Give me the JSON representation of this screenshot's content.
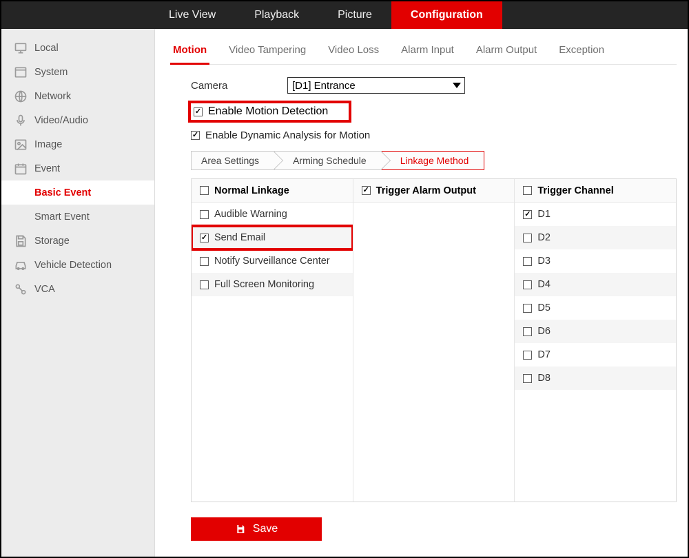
{
  "topnav": {
    "items": [
      {
        "label": "Live View",
        "active": false
      },
      {
        "label": "Playback",
        "active": false
      },
      {
        "label": "Picture",
        "active": false
      },
      {
        "label": "Configuration",
        "active": true
      }
    ]
  },
  "sidebar": {
    "items": [
      {
        "label": "Local"
      },
      {
        "label": "System"
      },
      {
        "label": "Network"
      },
      {
        "label": "Video/Audio"
      },
      {
        "label": "Image"
      },
      {
        "label": "Event"
      },
      {
        "label": "Storage"
      },
      {
        "label": "Vehicle Detection"
      },
      {
        "label": "VCA"
      }
    ],
    "event_subitems": [
      {
        "label": "Basic Event",
        "active": true
      },
      {
        "label": "Smart Event",
        "active": false
      }
    ]
  },
  "subtabs": [
    {
      "label": "Motion",
      "active": true
    },
    {
      "label": "Video Tampering",
      "active": false
    },
    {
      "label": "Video Loss",
      "active": false
    },
    {
      "label": "Alarm Input",
      "active": false
    },
    {
      "label": "Alarm Output",
      "active": false
    },
    {
      "label": "Exception",
      "active": false
    }
  ],
  "form": {
    "camera_label": "Camera",
    "camera_value": "[D1] Entrance",
    "enable_motion_label": "Enable Motion Detection",
    "enable_motion_checked": true,
    "enable_dynamic_label": "Enable Dynamic Analysis for Motion",
    "enable_dynamic_checked": true
  },
  "steps": [
    {
      "label": "Area Settings",
      "active": false
    },
    {
      "label": "Arming Schedule",
      "active": false
    },
    {
      "label": "Linkage Method",
      "active": true
    }
  ],
  "linkage": {
    "cols": [
      {
        "header": "Normal Linkage",
        "header_checked": false,
        "rows": [
          {
            "label": "Audible Warning",
            "checked": false,
            "highlight": false
          },
          {
            "label": "Send Email",
            "checked": true,
            "highlight": true
          },
          {
            "label": "Notify Surveillance Center",
            "checked": false,
            "highlight": false
          },
          {
            "label": "Full Screen Monitoring",
            "checked": false,
            "highlight": false
          }
        ]
      },
      {
        "header": "Trigger Alarm Output",
        "header_checked": true,
        "rows": []
      },
      {
        "header": "Trigger Channel",
        "header_checked": false,
        "rows": [
          {
            "label": "D1",
            "checked": true
          },
          {
            "label": "D2",
            "checked": false
          },
          {
            "label": "D3",
            "checked": false
          },
          {
            "label": "D4",
            "checked": false
          },
          {
            "label": "D5",
            "checked": false
          },
          {
            "label": "D6",
            "checked": false
          },
          {
            "label": "D7",
            "checked": false
          },
          {
            "label": "D8",
            "checked": false
          }
        ]
      }
    ]
  },
  "save_label": "Save"
}
